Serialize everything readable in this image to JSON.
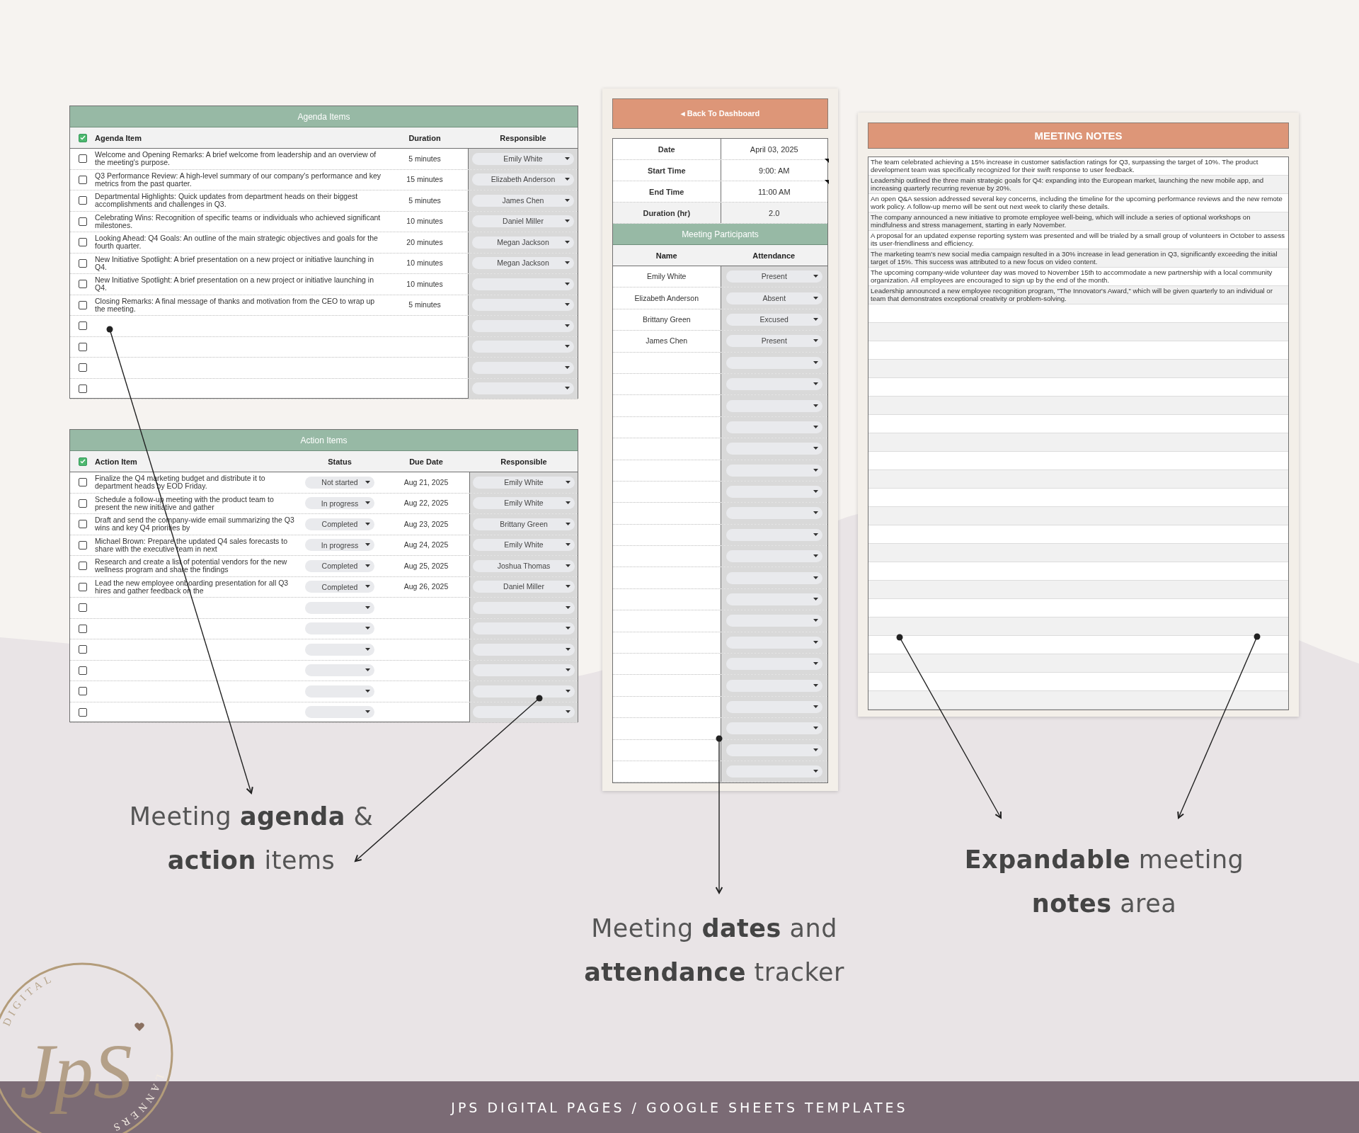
{
  "agenda": {
    "title": "Agenda Items",
    "header_checked": true,
    "columns": [
      "Agenda Item",
      "Duration",
      "Responsible"
    ],
    "rows": [
      {
        "checked": false,
        "item": "Welcome and Opening Remarks: A brief welcome from leadership and an overview of the meeting's purpose.",
        "duration": "5 minutes",
        "responsible": "Emily White"
      },
      {
        "checked": false,
        "item": "Q3 Performance Review: A high-level summary of our company's performance and key metrics from the past quarter.",
        "duration": "15 minutes",
        "responsible": "Elizabeth Anderson"
      },
      {
        "checked": false,
        "item": "Departmental Highlights: Quick updates from department heads on their biggest accomplishments and challenges in Q3.",
        "duration": "5 minutes",
        "responsible": "James Chen"
      },
      {
        "checked": false,
        "item": "Celebrating Wins: Recognition of specific teams or individuals who achieved significant milestones.",
        "duration": "10 minutes",
        "responsible": "Daniel Miller"
      },
      {
        "checked": false,
        "item": "Looking Ahead: Q4 Goals: An outline of the main strategic objectives and goals for the fourth quarter.",
        "duration": "20 minutes",
        "responsible": "Megan Jackson"
      },
      {
        "checked": false,
        "item": "New Initiative Spotlight: A brief presentation on a new project or initiative launching in Q4.",
        "duration": "10 minutes",
        "responsible": "Megan Jackson"
      },
      {
        "checked": false,
        "item": "New Initiative Spotlight: A brief presentation on a new project or initiative launching in Q4.",
        "duration": "10 minutes"
      },
      {
        "checked": false,
        "item": "Closing Remarks: A final message of thanks and motivation from the CEO to wrap up the meeting.",
        "duration": "5 minutes"
      },
      {
        "checked": false
      },
      {
        "checked": false
      },
      {
        "checked": false
      },
      {
        "checked": false
      }
    ]
  },
  "action_items": {
    "title": "Action Items",
    "header_checked": true,
    "columns": [
      "Action Item",
      "Status",
      "Due Date",
      "Responsible"
    ],
    "rows": [
      {
        "checked": false,
        "item": "Finalize the Q4 marketing budget and distribute it to department heads by EOD Friday.",
        "status": "Not started",
        "due": "Aug 21, 2025",
        "responsible": "Emily White"
      },
      {
        "checked": false,
        "item": "Schedule a follow-up meeting with the product team to present the new initiative and gather",
        "status": "In progress",
        "due": "Aug 22, 2025",
        "responsible": "Emily White"
      },
      {
        "checked": false,
        "item": "Draft and send the company-wide email summarizing the Q3 wins and key Q4 priorities by",
        "status": "Completed",
        "due": "Aug 23, 2025",
        "responsible": "Brittany Green"
      },
      {
        "checked": false,
        "item": "Michael Brown: Prepare the updated Q4 sales forecasts to share with the executive team in next",
        "status": "In progress",
        "due": "Aug 24, 2025",
        "responsible": "Emily White"
      },
      {
        "checked": false,
        "item": "Research and create a list of potential vendors for the new wellness program and share the findings",
        "status": "Completed",
        "due": "Aug 25, 2025",
        "responsible": "Joshua Thomas"
      },
      {
        "checked": false,
        "item": "Lead the new employee onboarding presentation for all Q3 hires and gather feedback on the",
        "status": "Completed",
        "due": "Aug 26, 2025",
        "responsible": "Daniel Miller"
      },
      {
        "checked": false
      },
      {
        "checked": false
      },
      {
        "checked": false
      },
      {
        "checked": false
      },
      {
        "checked": false
      },
      {
        "checked": false
      }
    ]
  },
  "dashboard_button": "◂ Back To Dashboard",
  "meeting_info": [
    {
      "label": "Date",
      "value": "April 03, 2025",
      "note": false
    },
    {
      "label": "Start Time",
      "value": "9:00: AM",
      "note": true
    },
    {
      "label": "End Time",
      "value": "11:00 AM",
      "note": true
    },
    {
      "label": "Duration (hr)",
      "value": "2.0",
      "note": false
    }
  ],
  "participants": {
    "title": "Meeting Participants",
    "columns": [
      "Name",
      "Attendance"
    ],
    "rows": [
      {
        "name": "Emily White",
        "attendance": "Present"
      },
      {
        "name": "Elizabeth Anderson",
        "attendance": "Absent"
      },
      {
        "name": "Brittany Green",
        "attendance": "Excused"
      },
      {
        "name": "James Chen",
        "attendance": "Present"
      }
    ]
  },
  "notes": {
    "title": "MEETING NOTES",
    "entries": [
      "The team celebrated achieving a 15% increase in customer satisfaction ratings for Q3, surpassing the target of 10%. The product development team was specifically recognized for their swift response to user feedback.",
      "Leadership outlined the three main strategic goals for Q4: expanding into the European market, launching the new mobile app, and increasing quarterly recurring revenue by 20%.",
      "An open Q&A session addressed several key concerns, including the timeline for the upcoming performance reviews and the new remote work policy. A follow-up memo will be sent out next week to clarify these details.",
      "The company announced a new initiative to promote employee well-being, which will include a series of optional workshops on mindfulness and stress management, starting in early November.",
      "A proposal for an updated expense reporting system was presented and will be trialed by a small group of volunteers in October to assess its user-friendliness and efficiency.",
      "The marketing team's new social media campaign resulted in a 30% increase in lead generation in Q3, significantly exceeding the initial target of 15%. This success was attributed to a new focus on video content.",
      "The upcoming company-wide volunteer day was moved to November 15th to accommodate a new partnership with a local community organization. All employees are encouraged to sign up by the end of the month.",
      "Leadership announced a new employee recognition program, \"The Innovator's Award,\" which will be given quarterly to an individual or team that demonstrates exceptional creativity or problem-solving."
    ]
  },
  "captions": [
    {
      "lines": [
        "Meeting **agenda** &",
        "**action** items"
      ]
    },
    {
      "lines": [
        "Meeting **dates** and",
        "**attendance** tracker"
      ]
    },
    {
      "lines": [
        "**Expandable** meeting",
        "**notes** area"
      ]
    }
  ],
  "logo": {
    "top_text": "DIGITAL",
    "side_text": "LANNERS",
    "monogram": "JpS"
  },
  "footer": "JPS DIGITAL PAGES / GOOGLE SHEETS TEMPLATES"
}
